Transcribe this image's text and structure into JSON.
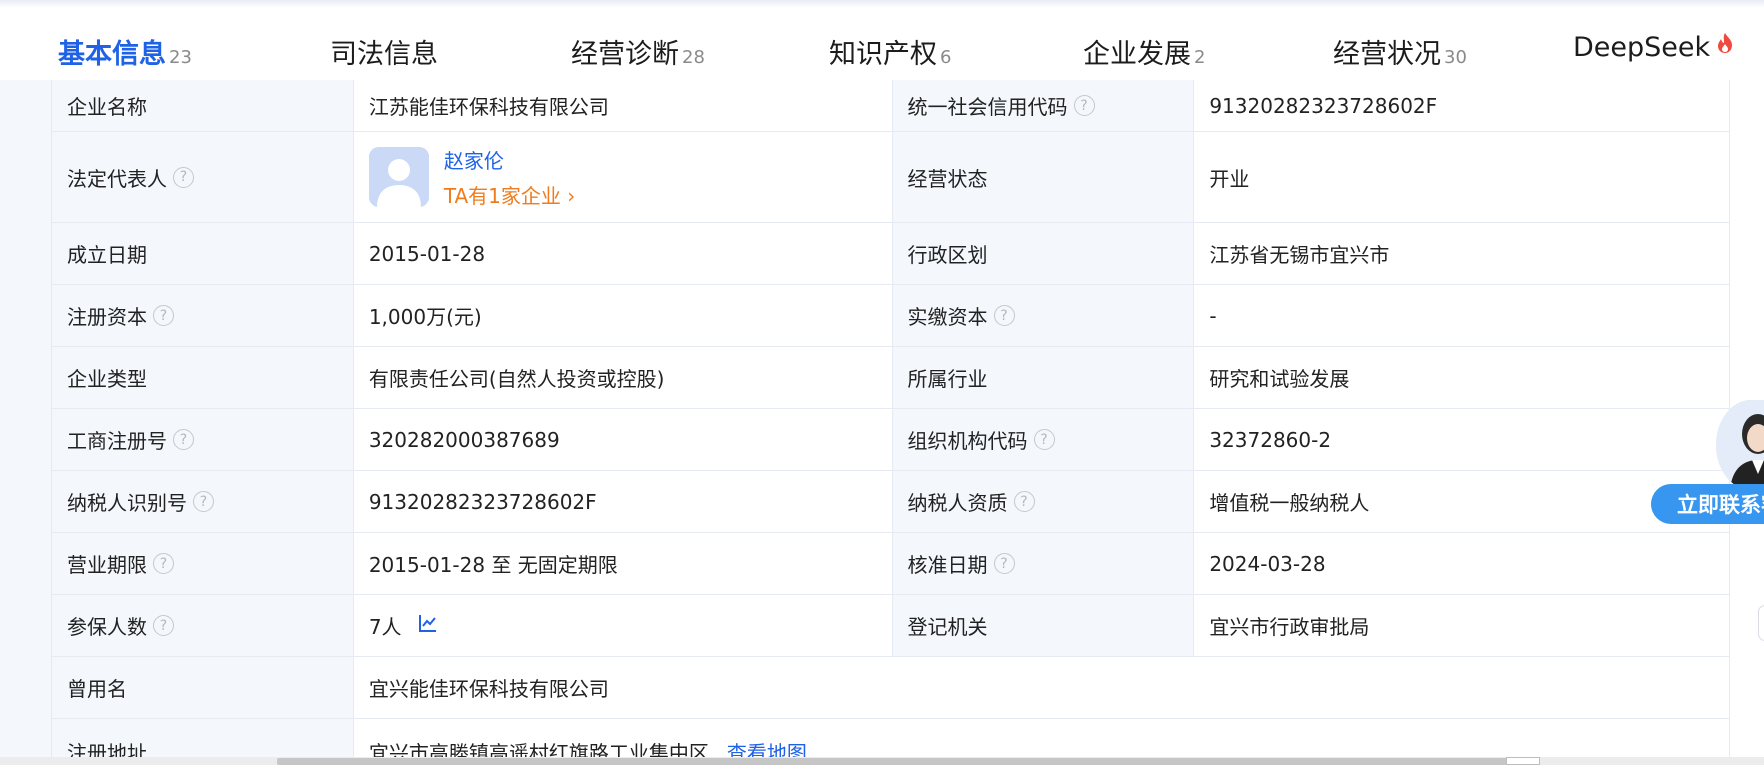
{
  "tabs": [
    {
      "label": "基本信息",
      "count": "23",
      "active": true
    },
    {
      "label": "司法信息",
      "count": ""
    },
    {
      "label": "经营诊断",
      "count": "28"
    },
    {
      "label": "知识产权",
      "count": "6"
    },
    {
      "label": "企业发展",
      "count": "2"
    },
    {
      "label": "经营状况",
      "count": "30"
    },
    {
      "label": "DeepSeek",
      "count": ""
    }
  ],
  "info": {
    "company_name_label": "企业名称",
    "company_name": "江苏能佳环保科技有限公司",
    "credit_code_label": "统一社会信用代码",
    "credit_code": "91320282323728602F",
    "legal_rep_label": "法定代表人",
    "legal_rep_name": "赵家伦",
    "legal_rep_link": "TA有1家企业",
    "status_label": "经营状态",
    "status": "开业",
    "founded_label": "成立日期",
    "founded": "2015-01-28",
    "region_label": "行政区划",
    "region": "江苏省无锡市宜兴市",
    "reg_capital_label": "注册资本",
    "reg_capital": "1,000万(元)",
    "paid_capital_label": "实缴资本",
    "paid_capital": "-",
    "type_label": "企业类型",
    "type": "有限责任公司(自然人投资或控股)",
    "industry_label": "所属行业",
    "industry": "研究和试验发展",
    "biz_reg_no_label": "工商注册号",
    "biz_reg_no": "320282000387689",
    "org_code_label": "组织机构代码",
    "org_code": "32372860-2",
    "taxpayer_id_label": "纳税人识别号",
    "taxpayer_id": "91320282323728602F",
    "taxpayer_qual_label": "纳税人资质",
    "taxpayer_qual": "增值税一般纳税人",
    "term_label": "营业期限",
    "term": "2015-01-28 至 无固定期限",
    "approval_label": "核准日期",
    "approval": "2024-03-28",
    "insured_label": "参保人数",
    "insured": "7人",
    "authority_label": "登记机关",
    "authority": "宜兴市行政审批局",
    "former_name_label": "曾用名",
    "former_name": "宜兴能佳环保科技有限公司",
    "address_label": "注册地址",
    "address": "宜兴市高塍镇高遥村红旗路工业集中区",
    "map_link": "查看地图"
  },
  "contact": {
    "button": "立即联系客服"
  },
  "colors": {
    "accent": "#1f62e6",
    "orange": "#f07c1e",
    "contact": "#3796f0"
  }
}
